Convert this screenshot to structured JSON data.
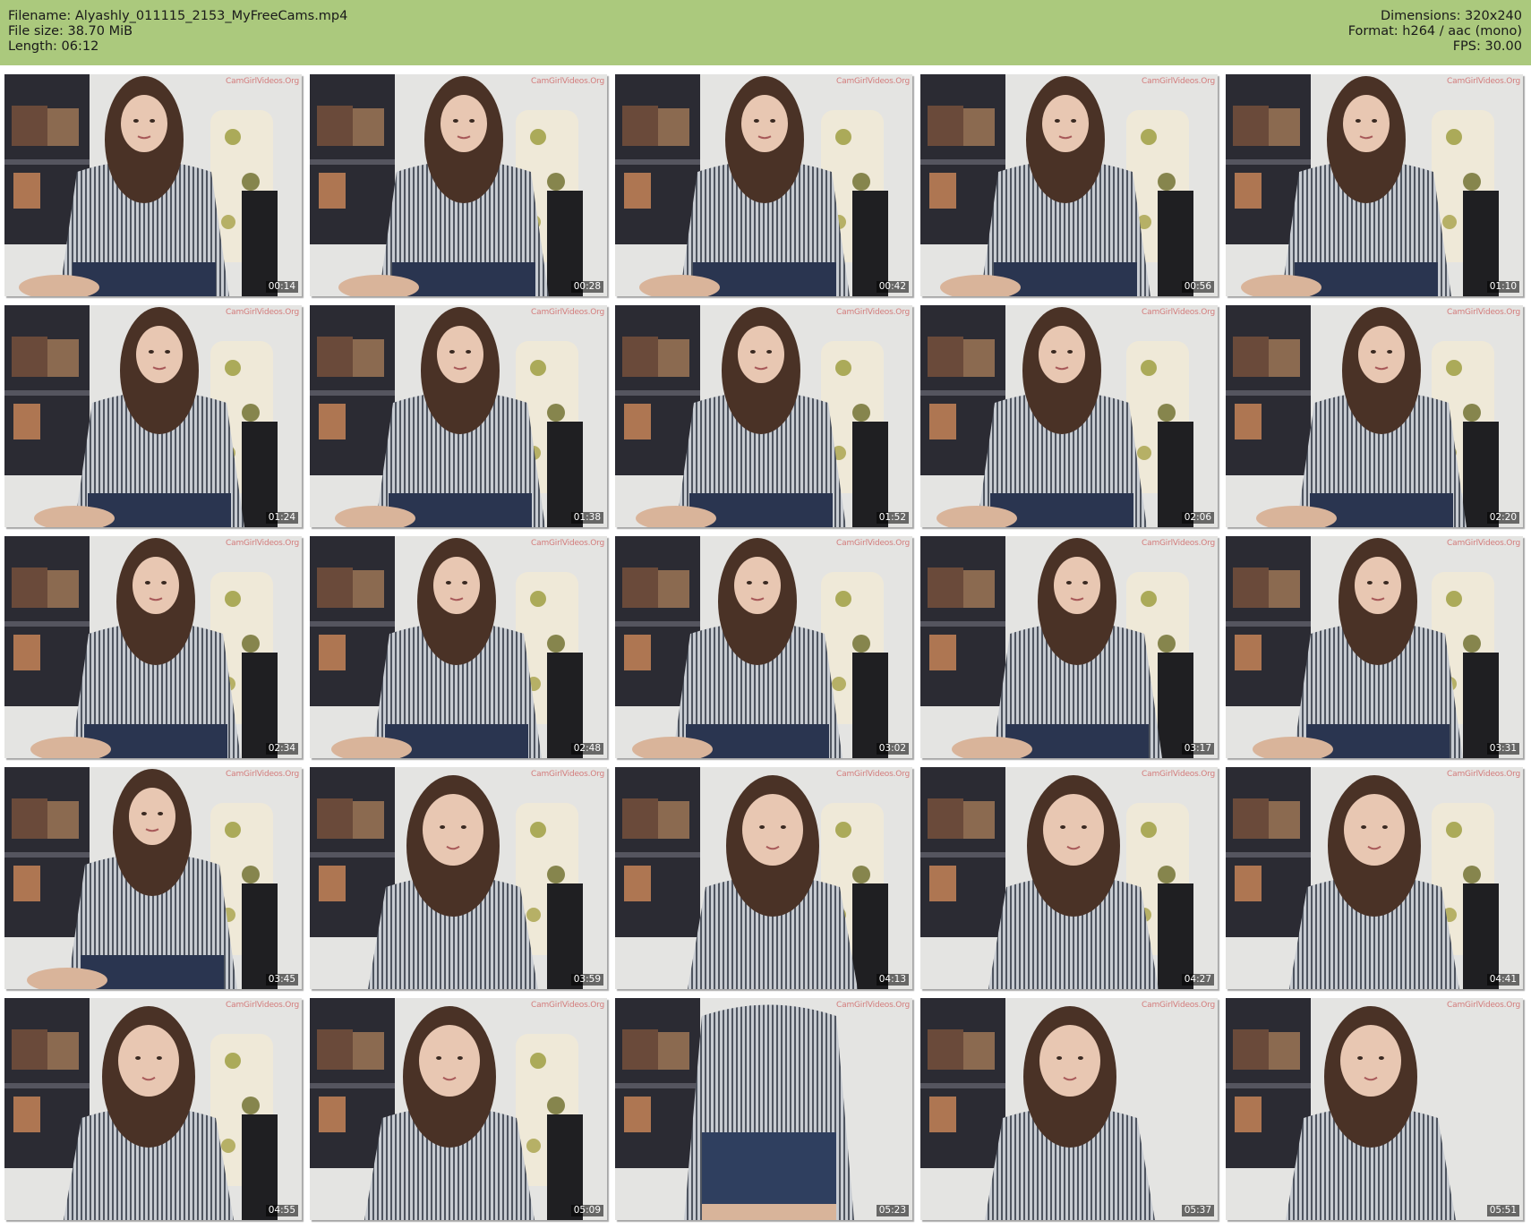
{
  "header": {
    "left": [
      "Filename: Alyashly_011115_2153_MyFreeCams.mp4",
      "File size: 38.70 MiB",
      "Length: 06:12"
    ],
    "right": [
      "Dimensions: 320x240",
      "Format: h264 / aac (mono)",
      "FPS: 30.00"
    ]
  },
  "watermark": "CamGirlVideos.Org",
  "thumbnails": [
    {
      "time": "00:14"
    },
    {
      "time": "00:28"
    },
    {
      "time": "00:42"
    },
    {
      "time": "00:56"
    },
    {
      "time": "01:10"
    },
    {
      "time": "01:24"
    },
    {
      "time": "01:38"
    },
    {
      "time": "01:52"
    },
    {
      "time": "02:06"
    },
    {
      "time": "02:20"
    },
    {
      "time": "02:34"
    },
    {
      "time": "02:48"
    },
    {
      "time": "03:02"
    },
    {
      "time": "03:17"
    },
    {
      "time": "03:31"
    },
    {
      "time": "03:45"
    },
    {
      "time": "03:59"
    },
    {
      "time": "04:13"
    },
    {
      "time": "04:27"
    },
    {
      "time": "04:41"
    },
    {
      "time": "04:55"
    },
    {
      "time": "05:09"
    },
    {
      "time": "05:23"
    },
    {
      "time": "05:37"
    },
    {
      "time": "05:51"
    }
  ]
}
